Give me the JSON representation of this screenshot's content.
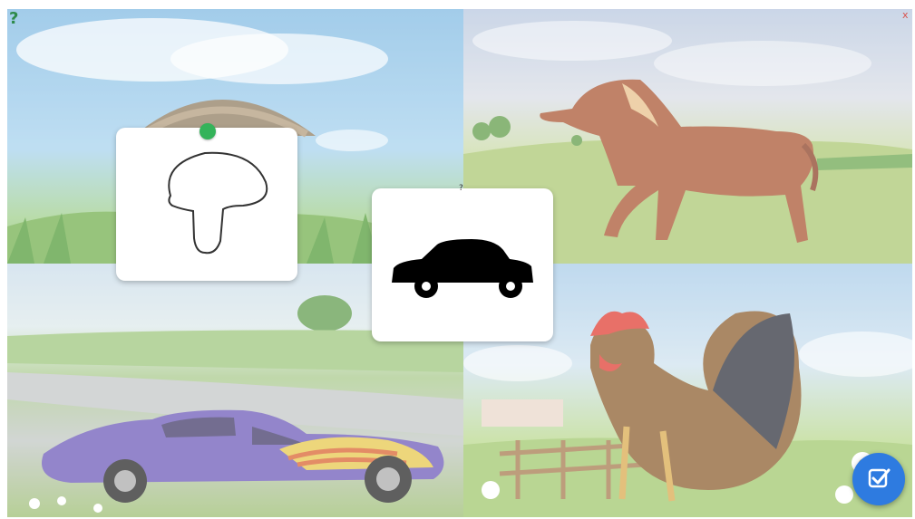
{
  "game": {
    "quadrants": [
      {
        "subject": "mushroom"
      },
      {
        "subject": "horse"
      },
      {
        "subject": "car"
      },
      {
        "subject": "rooster"
      }
    ],
    "cards": [
      {
        "icon": "mushroom-outline-icon",
        "placed": true
      },
      {
        "icon": "car-silhouette-icon",
        "placed": false,
        "marker": "?"
      }
    ]
  },
  "controls": {
    "help_icon": "help-icon",
    "close_label": "x",
    "check_icon": "check-icon",
    "check_color": "#2e7be0",
    "pin_color": "#34b35a"
  }
}
